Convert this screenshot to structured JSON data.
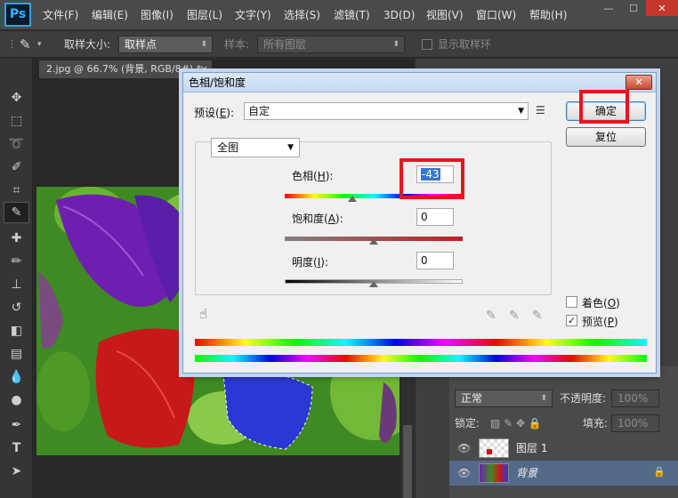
{
  "app": {
    "logo": "Ps",
    "menu": [
      "文件(F)",
      "编辑(E)",
      "图像(I)",
      "图层(L)",
      "文字(Y)",
      "选择(S)",
      "滤镜(T)",
      "3D(D)",
      "视图(V)",
      "窗口(W)",
      "帮助(H)"
    ],
    "window_controls": {
      "minimize": "—",
      "maximize": "☐",
      "close": "✕"
    }
  },
  "options_bar": {
    "sample_size_label": "取样大小:",
    "sample_size_value": "取样点",
    "sample_label": "样本:",
    "sample_value": "所有图层",
    "show_ring_label": "显示取样环"
  },
  "document": {
    "tab_title": "2.jpg @ 66.7% (背景, RGB/8#) *",
    "tab_close": "×"
  },
  "layers_panel": {
    "blend_mode": "正常",
    "opacity_label": "不透明度:",
    "opacity_value": "100%",
    "lock_label": "锁定:",
    "fill_label": "填充:",
    "fill_value": "100%",
    "layers": [
      {
        "name": "图层 1",
        "selected": false
      },
      {
        "name": "背景",
        "selected": true
      }
    ]
  },
  "dialog": {
    "title": "色相/饱和度",
    "close": "✕",
    "preset_label": "预设",
    "preset_key": "E",
    "preset_value": "自定",
    "channel": "全图",
    "hue_label": "色相",
    "hue_key": "H",
    "hue_value": "-43",
    "saturation_label": "饱和度",
    "saturation_key": "A",
    "saturation_value": "0",
    "lightness_label": "明度",
    "lightness_key": "I",
    "lightness_value": "0",
    "ok_button": "确定",
    "reset_button": "复位",
    "colorize_label": "着色",
    "colorize_key": "O",
    "colorize_checked": false,
    "preview_label": "预览",
    "preview_key": "P",
    "preview_checked": true,
    "slider_levels": {
      "hue": -43,
      "saturation": 0,
      "lightness": 0
    }
  },
  "colors": {
    "highlight": "#e8141e",
    "selection_blue": "#3478d0",
    "ps_blue": "#34b2f2"
  }
}
